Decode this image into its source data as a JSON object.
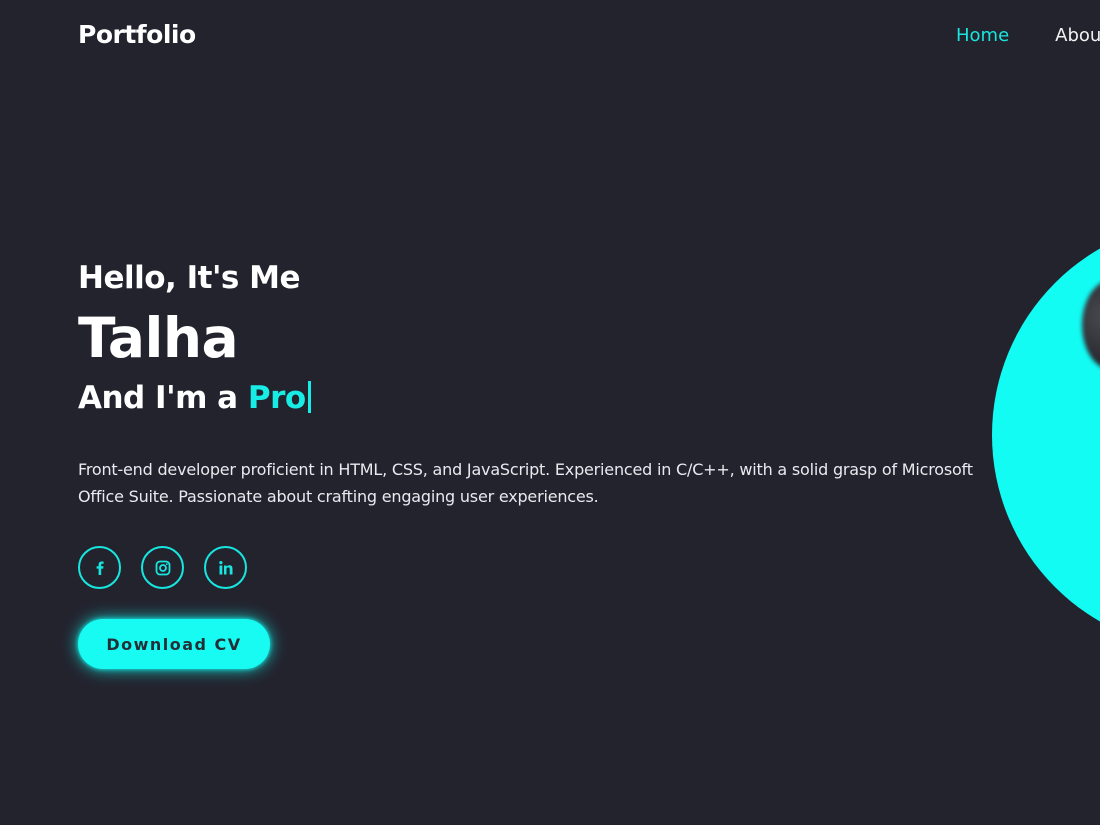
{
  "header": {
    "logo": "Portfolio",
    "nav": [
      "Home",
      "About"
    ]
  },
  "hero": {
    "greeting": "Hello, It's Me",
    "name": "Talha",
    "role_prefix": "And I'm a",
    "role_typed": "Pro",
    "bio": "Front-end developer proficient in HTML, CSS, and JavaScript. Experienced in C/C++, with a solid grasp of Microsoft Office Suite. Passionate about crafting engaging user experiences.",
    "social_icons": [
      "facebook-icon",
      "instagram-icon",
      "linkedin-icon"
    ],
    "download_label": "Download CV"
  },
  "colors": {
    "background": "#23232e",
    "accent": "#17ece5",
    "text": "#ffffff"
  }
}
